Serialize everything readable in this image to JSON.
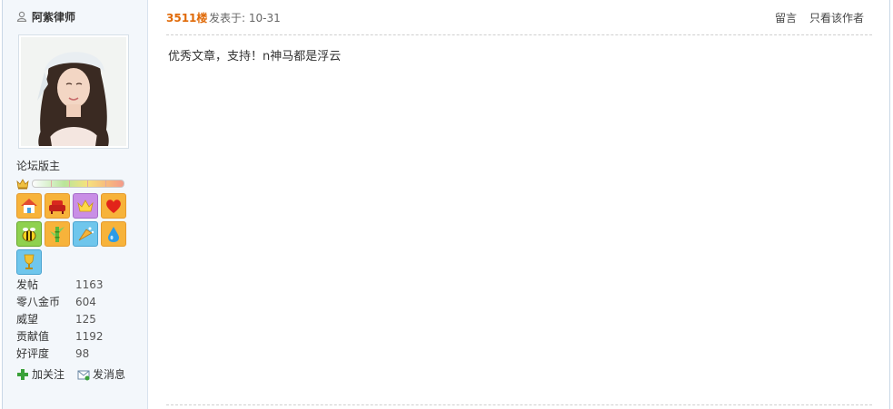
{
  "user": {
    "name": "阿紫律师",
    "role": "论坛版主",
    "stats": [
      {
        "label": "发帖",
        "value": "1163"
      },
      {
        "label": "零八金币",
        "value": "604"
      },
      {
        "label": "威望",
        "value": "125"
      },
      {
        "label": "贡献值",
        "value": "1192"
      },
      {
        "label": "好评度",
        "value": "98"
      }
    ],
    "actions": {
      "follow": "加关注",
      "message": "发消息"
    }
  },
  "medals": [
    {
      "icon": "house-icon",
      "bg": "#f7b33a"
    },
    {
      "icon": "sofa-icon",
      "bg": "#f7b33a"
    },
    {
      "icon": "crown-icon",
      "bg": "#c98ee6"
    },
    {
      "icon": "heart-icon",
      "bg": "#f7b33a"
    },
    {
      "icon": "bee-icon",
      "bg": "#8fd14f"
    },
    {
      "icon": "bamboo-icon",
      "bg": "#f7b33a"
    },
    {
      "icon": "cheer-icon",
      "bg": "#6fc6ec"
    },
    {
      "icon": "water-drop-icon",
      "bg": "#f7b33a"
    },
    {
      "icon": "trophy-icon",
      "bg": "#6fc6ec"
    }
  ],
  "post": {
    "floor": "3511楼",
    "posted": "发表于: 10-31",
    "reply_link": "留言",
    "author_only_link": "只看该作者",
    "content": "优秀文章，支持！n神马都是浮云"
  }
}
